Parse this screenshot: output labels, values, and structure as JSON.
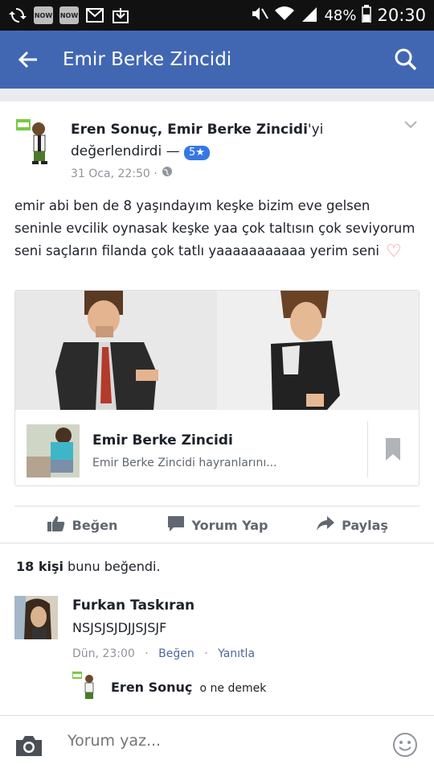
{
  "status_bar": {
    "now_badge_1": "NOW",
    "now_badge_2": "NOW",
    "battery": "48%",
    "time": "20:30"
  },
  "app_bar": {
    "title": "Emir Berke Zincidi",
    "back_icon": "arrow-left-icon",
    "search_icon": "search-icon"
  },
  "post": {
    "author_line_prefix": "Eren Sonuç, Emir Berke Zincidi",
    "author_line_suffix": "'yi",
    "action_text": "değerlendirdi —",
    "rating": "5★",
    "timestamp": "31 Oca, 22:50 ·",
    "body_text": "emir abi ben de 8 yaşındayım keşke bizim eve gelsen seninle evcilik oynasak keşke yaa çok taltısın çok seviyorum seni saçların filanda çok tatlı yaaaaaaaaaaa yerim seni",
    "heart": "♡",
    "link_card": {
      "title": "Emir Berke Zincidi",
      "subtitle": "Emir Berke Zincidi hayranlarını..."
    },
    "actions": {
      "like": "Beğen",
      "comment": "Yorum Yap",
      "share": "Paylaş"
    },
    "likes_count": "18 kişi",
    "likes_suffix": " bunu beğendi."
  },
  "comment": {
    "name": "Furkan Taskıran",
    "text": "NSJSJSJDJJSJSJF",
    "time": "Dün, 23:00",
    "like_link": "Beğen",
    "reply_link": "Yanıtla",
    "dot": "·",
    "reply": {
      "name": "Eren Sonuç",
      "text": "o ne demek"
    }
  },
  "composer": {
    "placeholder": "Yorum yaz..."
  },
  "colors": {
    "brand": "#4267b2",
    "link": "#4b67a1",
    "muted": "#90949c"
  }
}
